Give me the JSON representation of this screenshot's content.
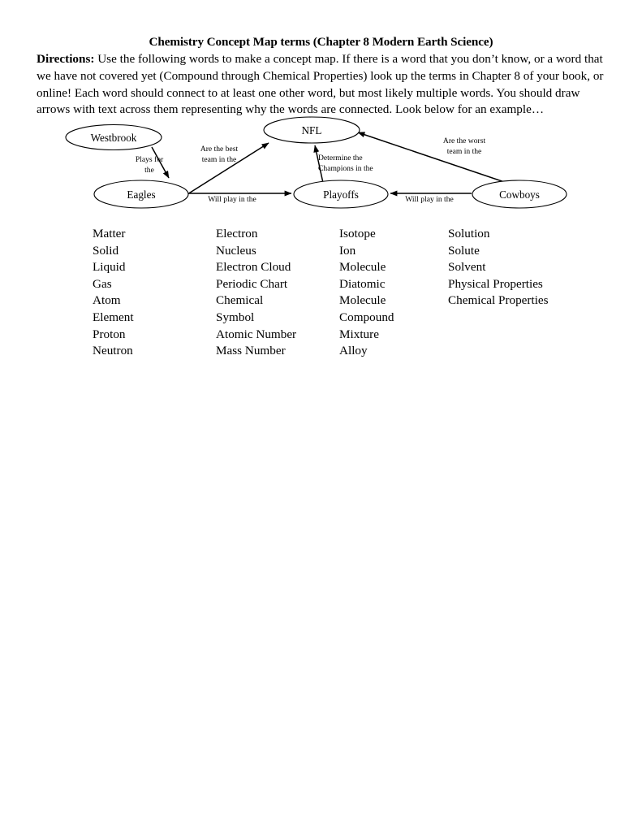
{
  "document": {
    "title": "Chemistry Concept Map terms (Chapter 8 Modern Earth Science)",
    "directions_label": "Directions:",
    "directions_body": " Use the following words to make a concept map. If there is a word that you don’t know, or a word that we have not covered yet (Compound through Chemical Properties) look up the terms in Chapter 8 of your book, or online! Each word should connect to at least one other word, but most likely multiple words. You should draw arrows with text across them representing why the words are connected. Look below for an example…"
  },
  "concept_map": {
    "nodes": [
      {
        "id": "westbrook",
        "label": "Westbrook"
      },
      {
        "id": "eagles",
        "label": "Eagles"
      },
      {
        "id": "nfl",
        "label": "NFL"
      },
      {
        "id": "playoffs",
        "label": "Playoffs"
      },
      {
        "id": "cowboys",
        "label": "Cowboys"
      }
    ],
    "edges": [
      {
        "id": "westbrook-eagles",
        "from": "westbrook",
        "to": "eagles",
        "label_line1": "Plays for",
        "label_line2": "the"
      },
      {
        "id": "eagles-nfl",
        "from": "eagles",
        "to": "nfl",
        "label_line1": "Are the best",
        "label_line2": "team in the"
      },
      {
        "id": "eagles-playoffs",
        "from": "eagles",
        "to": "playoffs",
        "label_line1": "Will play in the",
        "label_line2": ""
      },
      {
        "id": "playoffs-nfl",
        "from": "playoffs",
        "to": "nfl",
        "label_line1": "Determine the",
        "label_line2": "Champions in the"
      },
      {
        "id": "cowboys-playoffs",
        "from": "cowboys",
        "to": "playoffs",
        "label_line1": "Will play in the",
        "label_line2": ""
      },
      {
        "id": "cowboys-nfl",
        "from": "cowboys",
        "to": "nfl",
        "label_line1": "Are the worst",
        "label_line2": "team in the"
      }
    ]
  },
  "word_list": {
    "columns": [
      {
        "id": "column-1",
        "words": [
          "Matter",
          "Solid",
          "Liquid",
          "Gas",
          "Atom",
          "Element",
          "Proton",
          "Neutron"
        ]
      },
      {
        "id": "column-2",
        "words": [
          "Electron",
          "Nucleus",
          "Electron Cloud",
          "Periodic Chart",
          "Chemical",
          "Symbol",
          "Atomic Number",
          "Mass Number"
        ]
      },
      {
        "id": "column-3",
        "words": [
          "Isotope",
          "Ion",
          "Molecule",
          "Diatomic",
          "Molecule",
          "Compound",
          "Mixture",
          "Alloy"
        ]
      },
      {
        "id": "column-4",
        "words": [
          "Solution",
          "Solute",
          "Solvent",
          "Physical Properties",
          "Chemical Properties"
        ]
      }
    ]
  }
}
